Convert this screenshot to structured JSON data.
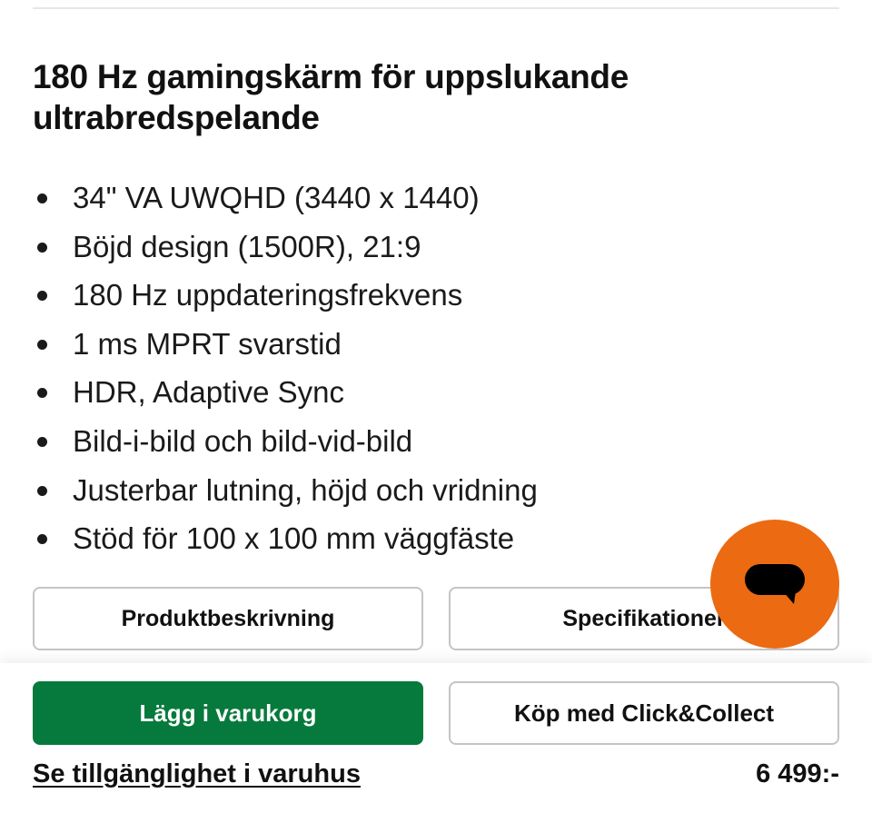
{
  "product": {
    "title": "180 Hz gamingskärm för uppslukande ultrabredspelande",
    "features": [
      "34\" VA UWQHD (3440 x 1440)",
      "Böjd design (1500R), 21:9",
      "180 Hz uppdateringsfrekvens",
      "1 ms MPRT svarstid",
      "HDR, Adaptive Sync",
      "Bild-i-bild och bild-vid-bild",
      "Justerbar lutning, höjd och vridning",
      "Stöd för 100 x 100 mm väggfäste"
    ]
  },
  "tabs": {
    "description_label": "Produktbeskrivning",
    "specifications_label": "Specifikationer"
  },
  "actions": {
    "add_to_cart_label": "Lägg i varukorg",
    "click_collect_label": "Köp med Click&Collect",
    "store_availability_label": "Se tillgänglighet i varuhus",
    "price": "6 499:-"
  },
  "chat": {
    "icon": "chat-bubble-icon"
  },
  "colors": {
    "primary_green": "#067a3c",
    "chat_orange": "#ec6a12",
    "border_gray": "#c4c4c4"
  }
}
